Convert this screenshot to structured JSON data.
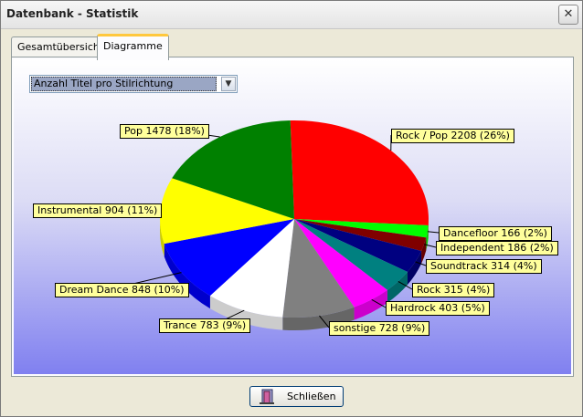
{
  "window": {
    "title": "Datenbank - Statistik",
    "close_symbol": "✕"
  },
  "tabs": [
    {
      "label": "Gesamtübersicht",
      "active": false
    },
    {
      "label": "Diagramme",
      "active": true
    }
  ],
  "selector": {
    "value": "Anzahl Titel pro Stilrichtung",
    "arrow": "▼"
  },
  "chart_data": {
    "type": "pie",
    "slices": [
      {
        "name": "Rock / Pop",
        "value": 2208,
        "percent": 26,
        "color": "#ff0000",
        "label": "Rock / Pop  2208  (26%)"
      },
      {
        "name": "Dancefloor",
        "value": 166,
        "percent": 2,
        "color": "#00ff00",
        "label": "Dancefloor  166  (2%)"
      },
      {
        "name": "Independent",
        "value": 186,
        "percent": 2,
        "color": "#800000",
        "label": "Independent  186  (2%)"
      },
      {
        "name": "Soundtrack",
        "value": 314,
        "percent": 4,
        "color": "#000080",
        "label": "Soundtrack  314  (4%)"
      },
      {
        "name": "Rock",
        "value": 315,
        "percent": 4,
        "color": "#008080",
        "label": "Rock  315  (4%)"
      },
      {
        "name": "Hardrock",
        "value": 403,
        "percent": 5,
        "color": "#ff00ff",
        "label": "Hardrock  403  (5%)"
      },
      {
        "name": "sonstige",
        "value": 728,
        "percent": 9,
        "color": "#808080",
        "label": "sonstige  728  (9%)"
      },
      {
        "name": "Trance",
        "value": 783,
        "percent": 9,
        "color": "#ffffff",
        "label": "Trance  783  (9%)"
      },
      {
        "name": "Dream Dance",
        "value": 848,
        "percent": 10,
        "color": "#0000ff",
        "label": "Dream Dance  848  (10%)"
      },
      {
        "name": "Instrumental",
        "value": 904,
        "percent": 11,
        "color": "#ffff00",
        "label": "Instrumental  904  (11%)"
      },
      {
        "name": "Pop",
        "value": 1478,
        "percent": 18,
        "color": "#008000",
        "label": "Pop  1478  (18%)"
      }
    ]
  },
  "footer": {
    "close_label": "Schließen"
  }
}
